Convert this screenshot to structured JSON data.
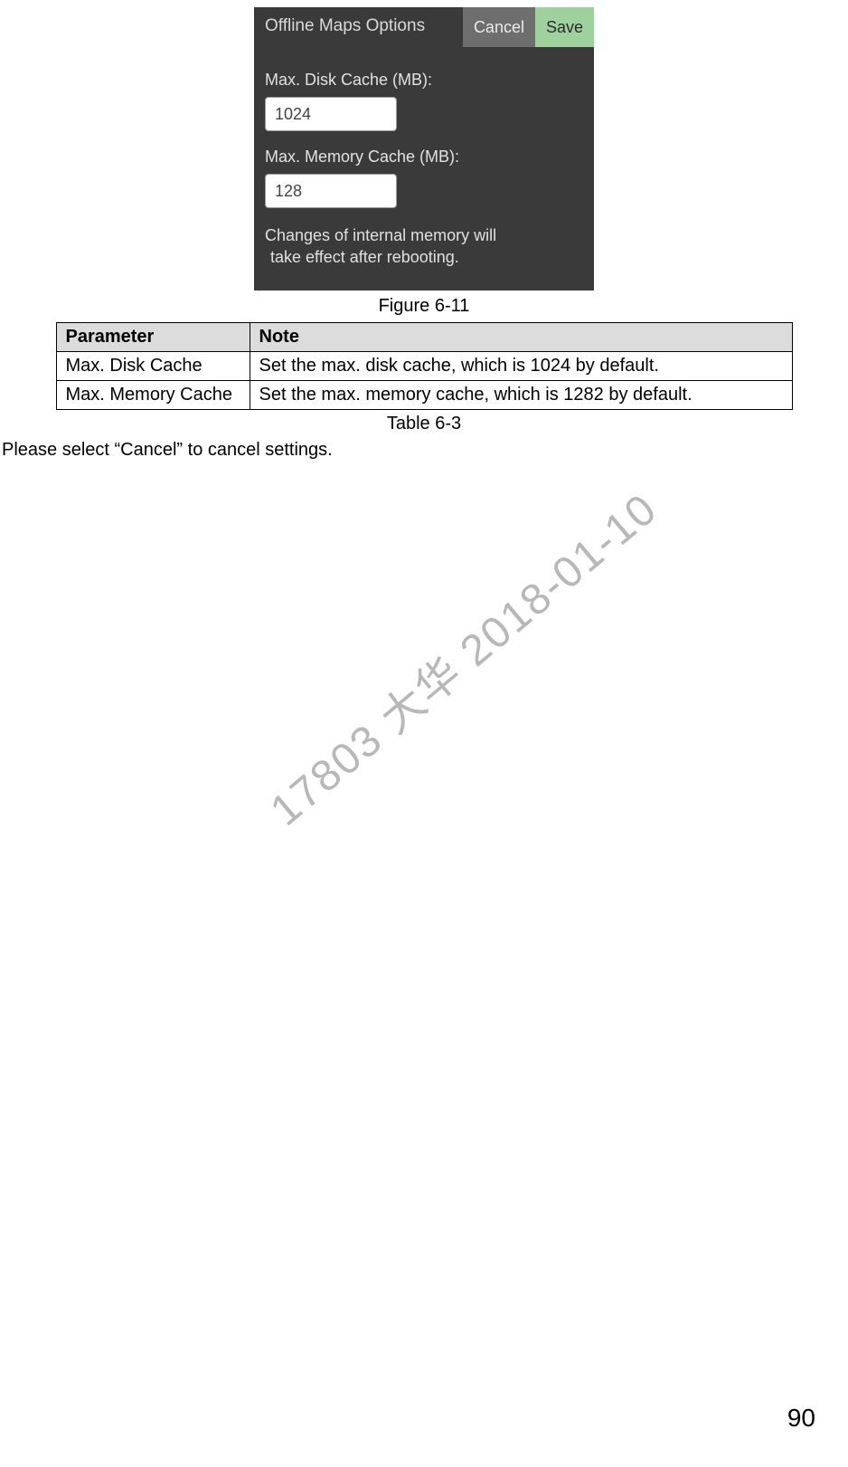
{
  "dialog": {
    "title": "Offline Maps Options",
    "cancel": "Cancel",
    "save": "Save",
    "disk_label": "Max. Disk Cache (MB):",
    "disk_value": "1024",
    "memory_label": "Max. Memory Cache (MB):",
    "memory_value": "128",
    "note_line1": "Changes of internal memory will",
    "note_line2": "take effect after rebooting."
  },
  "figure_caption": "Figure 6-11",
  "table": {
    "headers": {
      "param": "Parameter",
      "note": "Note"
    },
    "rows": [
      {
        "param": "Max. Disk Cache",
        "note": "Set the max. disk cache, which is 1024 by default."
      },
      {
        "param": "Max. Memory Cache",
        "note": "Set the max. memory cache, which is 1282 by default."
      }
    ],
    "caption": "Table 6-3"
  },
  "body_text": "Please select “Cancel” to cancel settings.",
  "watermark": "17803 大华 2018-01-10",
  "page_number": "90"
}
